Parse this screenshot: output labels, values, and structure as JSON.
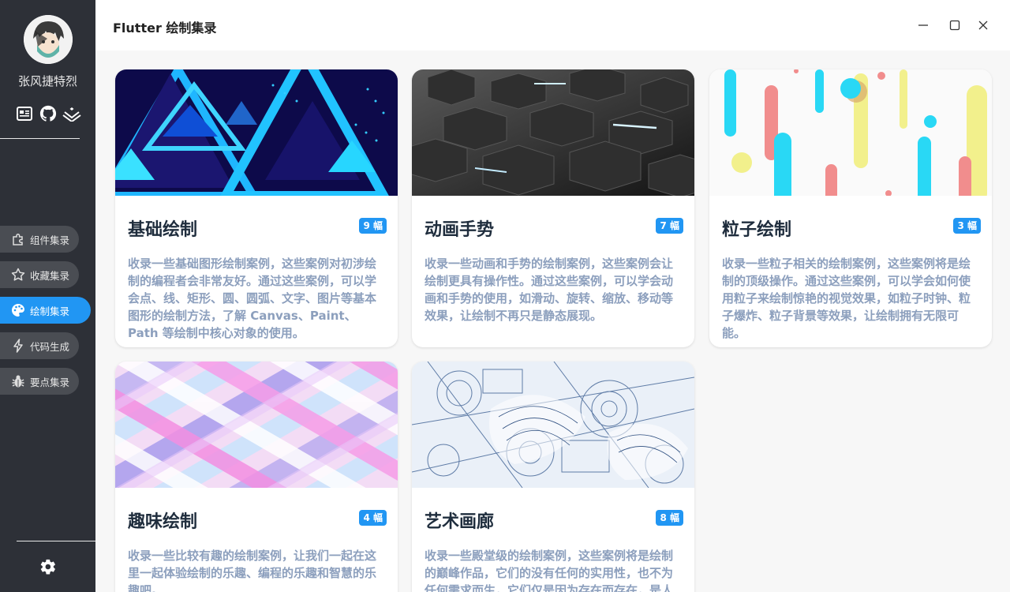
{
  "app": {
    "title": "Flutter 绘制集录"
  },
  "sidebar": {
    "username": "张风捷特烈",
    "social_icons": [
      "article-icon",
      "github-icon",
      "juejin-icon"
    ],
    "nav": [
      {
        "label": "组件集录",
        "icon": "puzzle-icon",
        "active": false
      },
      {
        "label": "收藏集录",
        "icon": "star-icon",
        "active": false
      },
      {
        "label": "绘制集录",
        "icon": "palette-icon",
        "active": true
      },
      {
        "label": "代码生成",
        "icon": "lightning-icon",
        "active": false
      },
      {
        "label": "要点集录",
        "icon": "bug-icon",
        "active": false
      }
    ],
    "settings_icon": "gear-icon"
  },
  "window_controls": [
    "minimize-icon",
    "maximize-icon",
    "close-icon"
  ],
  "cards": [
    {
      "title": "基础绘制",
      "badge": "9 幅",
      "desc": "收录一些基础图形绘制案例，这些案例对初涉绘制的编程者会非常友好。通过这些案例，可以学会点、线、矩形、圆、圆弧、文字、图片等基本图形的绘制方法，了解 Canvas、Paint、Path 等绘制中核心对象的使用。"
    },
    {
      "title": "动画手势",
      "badge": "7 幅",
      "desc": "收录一些动画和手势的绘制案例，这些案例会让绘制更具有操作性。通过这些案例，可以学会动画和手势的使用，如滑动、旋转、缩放、移动等效果，让绘制不再只是静态展现。"
    },
    {
      "title": "粒子绘制",
      "badge": "3 幅",
      "desc": "收录一些粒子相关的绘制案例，这些案例将是绘制的顶级操作。通过这些案例，可以学会如何使用粒子来绘制惊艳的视觉效果，如粒子时钟、粒子爆炸、粒子背景等效果，让绘制拥有无限可能。"
    },
    {
      "title": "趣味绘制",
      "badge": "4 幅",
      "desc": "收录一些比较有趣的绘制案例，让我们一起在这里一起体验绘制的乐趣、编程的乐趣和智慧的乐趣吧。"
    },
    {
      "title": "艺术画廊",
      "badge": "8 幅",
      "desc": "收录一些殿堂级的绘制案例，这些案例将是绘制的巅峰作品，它们的没有任何的实用性，也不为任何需求而生，它们仅是因为存在而存在，是人"
    }
  ],
  "colors": {
    "sidebar_bg": "#2d3037",
    "accent": "#2196f3",
    "card_title": "#1f2d3d",
    "card_desc": "#8c9fbd"
  }
}
